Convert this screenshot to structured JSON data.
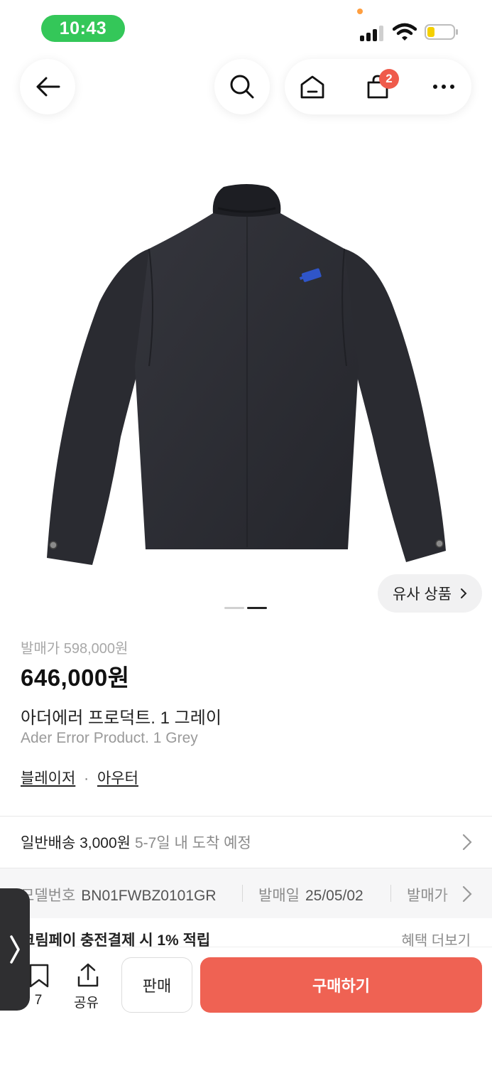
{
  "status_bar": {
    "time": "10:43"
  },
  "header": {
    "back_icon": "arrow-left-icon",
    "search_icon": "search-icon",
    "home_icon": "home-icon",
    "cart_icon": "shopping-bag-icon",
    "cart_count": "2",
    "more_icon": "more-horizontal-icon"
  },
  "gallery": {
    "similar_label": "유사 상품",
    "page_count": 2,
    "active_page": 2
  },
  "product": {
    "release_price_label": "발매가 598,000원",
    "price": "646,000원",
    "name_ko": "아더에러 프로덕트. 1 그레이",
    "name_en": "Ader Error Product. 1 Grey",
    "categories": [
      "블레이저",
      "아우터"
    ],
    "category_separator": "·"
  },
  "delivery": {
    "label": "일반배송 3,000원",
    "eta": "5-7일 내 도착 예정"
  },
  "specs": [
    {
      "label": "모델번호",
      "value": "BN01FWBZ0101GR"
    },
    {
      "label": "발매일",
      "value": "25/05/02"
    },
    {
      "label": "발매가",
      "value": ""
    }
  ],
  "promo": {
    "text": "크림페이 충전결제 시 1% 적립",
    "more": "혜택 더보기"
  },
  "bottom_bar": {
    "bookmark_count": "7",
    "share_label": "공유",
    "sell_label": "판매",
    "buy_label": "구매하기"
  },
  "colors": {
    "accent": "#ef6253",
    "badge": "#ef5b4c",
    "time_pill": "#34c759"
  }
}
